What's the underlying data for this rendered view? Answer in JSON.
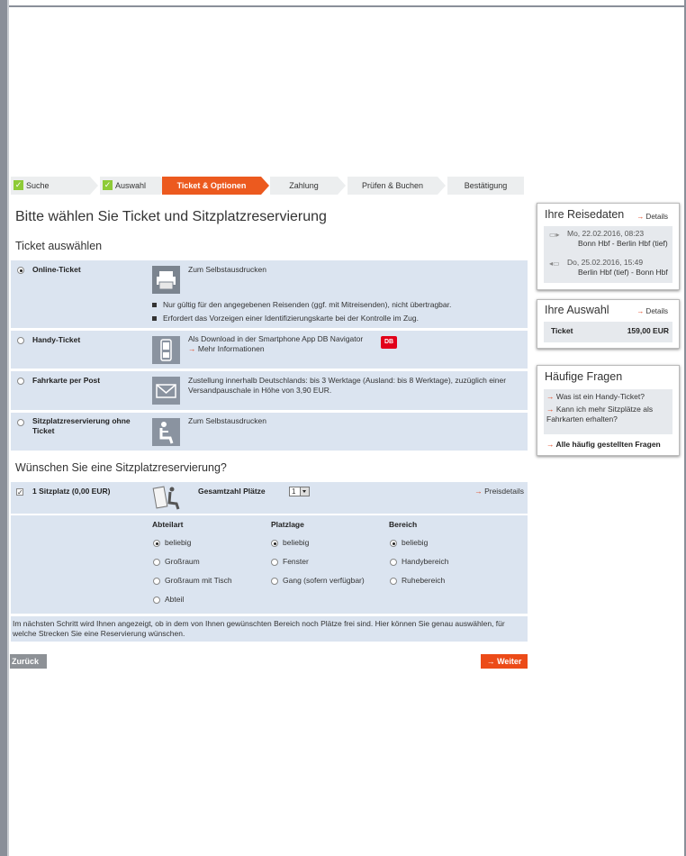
{
  "steps": [
    {
      "label": "Suche",
      "state": "done"
    },
    {
      "label": "Auswahl",
      "state": "done"
    },
    {
      "label": "Ticket & Optionen",
      "state": "active"
    },
    {
      "label": "Zahlung",
      "state": "todo"
    },
    {
      "label": "Prüfen & Buchen",
      "state": "todo"
    },
    {
      "label": "Bestätigung",
      "state": "todo"
    }
  ],
  "page_title": "Bitte wählen Sie Ticket und Sitzplatzreservierung",
  "ticket_section_title": "Ticket auswählen",
  "ticket_options": [
    {
      "label": "Online-Ticket",
      "selected": true,
      "icon": "printer-icon",
      "desc": "Zum Selbstausdrucken",
      "notes": [
        "Nur gültig für den angegebenen Reisenden (ggf. mit Mitreisenden), nicht übertragbar.",
        "Erfordert das Vorzeigen einer Identifizierungskarte bei der Kontrolle im Zug."
      ]
    },
    {
      "label": "Handy-Ticket",
      "selected": false,
      "icon": "mobile-phone-icon",
      "desc": "Als Download in der Smartphone App DB Navigator",
      "link": "Mehr Informationen"
    },
    {
      "label": "Fahrkarte per Post",
      "selected": false,
      "icon": "envelope-icon",
      "desc": "Zustellung innerhalb Deutschlands: bis 3 Werktage (Ausland: bis 8 Werktage), zuzüglich einer Versandpauschale in Höhe von 3,90 EUR."
    },
    {
      "label": "Sitzplatzreservierung ohne Ticket",
      "selected": false,
      "icon": "seat-icon",
      "desc": "Zum Selbstausdrucken"
    }
  ],
  "db_logo_text": "DB",
  "reservation_section_title": "Wünschen Sie eine Sitzplatzreservierung?",
  "reservation": {
    "checkbox_label": "1 Sitzplatz (0,00 EUR)",
    "checked": true,
    "total_label": "Gesamtzahl Plätze",
    "total_value": "1",
    "price_details_link": "Preisdetails",
    "columns": [
      {
        "header": "Abteilart",
        "options": [
          "beliebig",
          "Großraum",
          "Großraum mit Tisch",
          "Abteil"
        ],
        "selected": 0
      },
      {
        "header": "Platzlage",
        "options": [
          "beliebig",
          "Fenster",
          "Gang (sofern verfügbar)"
        ],
        "selected": 0
      },
      {
        "header": "Bereich",
        "options": [
          "beliebig",
          "Handybereich",
          "Ruhebereich"
        ],
        "selected": 0
      }
    ],
    "info_text": "Im nächsten Schritt wird Ihnen angezeigt, ob in dem von Ihnen gewünschten Bereich noch Plätze frei sind. Hier können Sie genau auswählen, für welche Strecken Sie eine Reservierung wünschen."
  },
  "buttons": {
    "back": "Zurück",
    "next": "Weiter"
  },
  "sidebar": {
    "travel": {
      "title": "Ihre Reisedaten",
      "details_link": "Details",
      "trips": [
        {
          "date": "Mo, 22.02.2016, 08:23",
          "route": "Bonn Hbf - Berlin Hbf (tief)"
        },
        {
          "date": "Do, 25.02.2016, 15:49",
          "route": "Berlin Hbf (tief) - Bonn Hbf"
        }
      ]
    },
    "selection": {
      "title": "Ihre Auswahl",
      "details_link": "Details",
      "item_label": "Ticket",
      "item_value": "159,00 EUR"
    },
    "faq": {
      "title": "Häufige Fragen",
      "questions": [
        "Was ist ein Handy-Ticket?",
        "Kann ich mehr Sitzplätze als Fahrkarten erhalten?"
      ],
      "all_link": "Alle häufig gestellten Fragen"
    }
  },
  "colors": {
    "accent": "#ec5a1f",
    "row_bg": "#dbe4f0",
    "check_green": "#8ecb38",
    "db_red": "#e2001a"
  }
}
